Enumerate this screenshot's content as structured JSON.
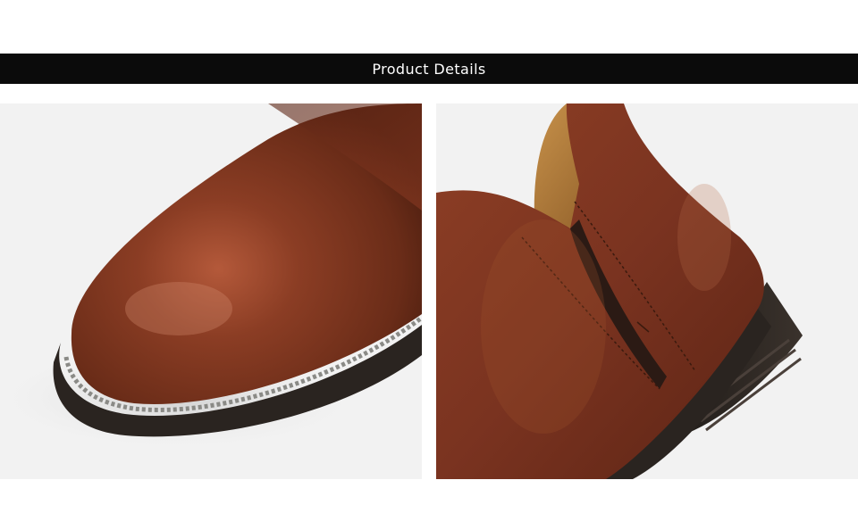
{
  "header": {
    "title": "Product Details"
  },
  "gallery": {
    "images": [
      {
        "name": "toe-closeup",
        "icon": "boot-toe-photo"
      },
      {
        "name": "side-closeup",
        "icon": "boot-side-photo"
      }
    ]
  },
  "colors": {
    "banner_bg": "#0b0b0b",
    "banner_text": "#ffffff",
    "photo_bg": "#f2f2f2",
    "leather": "#7a3520",
    "sole": "#2a2420"
  }
}
